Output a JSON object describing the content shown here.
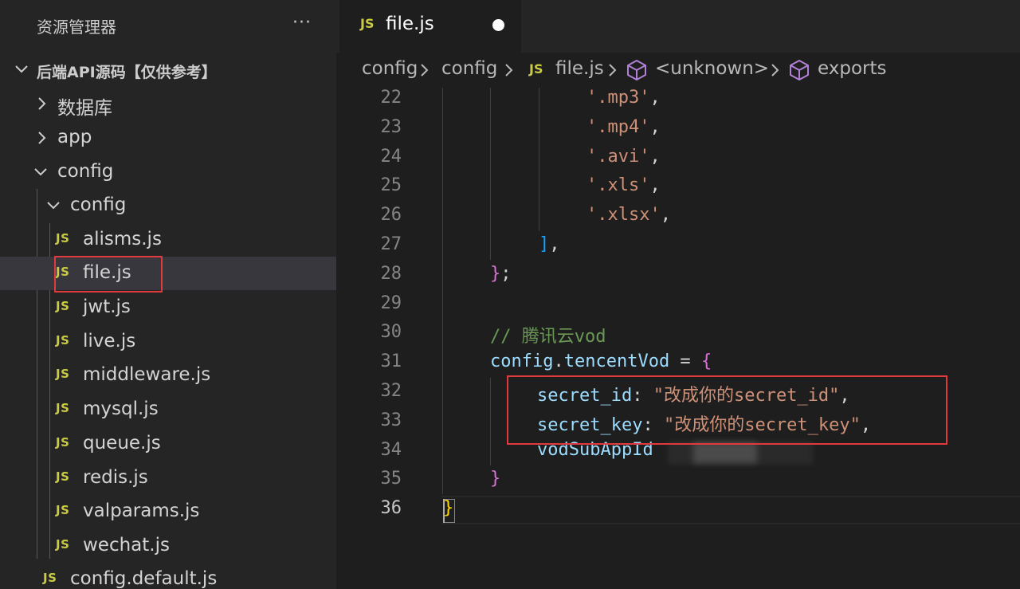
{
  "sidebar": {
    "title": "资源管理器",
    "more_label": "···",
    "root": "后端API源码【仅供参考】",
    "items": [
      {
        "label": "数据库",
        "kind": "folder",
        "expanded": false
      },
      {
        "label": "app",
        "kind": "folder",
        "expanded": false
      },
      {
        "label": "config",
        "kind": "folder",
        "expanded": true
      },
      {
        "label": "config",
        "kind": "folder",
        "expanded": true
      },
      {
        "label": "alisms.js",
        "kind": "js"
      },
      {
        "label": "file.js",
        "kind": "js",
        "selected": true
      },
      {
        "label": "jwt.js",
        "kind": "js"
      },
      {
        "label": "live.js",
        "kind": "js"
      },
      {
        "label": "middleware.js",
        "kind": "js"
      },
      {
        "label": "mysql.js",
        "kind": "js"
      },
      {
        "label": "queue.js",
        "kind": "js"
      },
      {
        "label": "redis.js",
        "kind": "js"
      },
      {
        "label": "valparams.js",
        "kind": "js"
      },
      {
        "label": "wechat.js",
        "kind": "js"
      },
      {
        "label": "config.default.js",
        "kind": "js"
      }
    ],
    "js_badge": "JS"
  },
  "tab": {
    "icon": "JS",
    "label": "file.js",
    "dirty": true
  },
  "breadcrumbs": {
    "items": [
      "config",
      "config",
      "file.js",
      "<unknown>",
      "exports"
    ],
    "file_icon": "JS"
  },
  "editor": {
    "lines": [
      {
        "n": "22",
        "segments": [
          {
            "t": "'.mp3'",
            "c": "str"
          },
          {
            "t": ",",
            "c": "punc"
          }
        ]
      },
      {
        "n": "23",
        "segments": [
          {
            "t": "'.mp4'",
            "c": "str"
          },
          {
            "t": ",",
            "c": "punc"
          }
        ]
      },
      {
        "n": "24",
        "segments": [
          {
            "t": "'.avi'",
            "c": "str"
          },
          {
            "t": ",",
            "c": "punc"
          }
        ]
      },
      {
        "n": "25",
        "segments": [
          {
            "t": "'.xls'",
            "c": "str"
          },
          {
            "t": ",",
            "c": "punc"
          }
        ]
      },
      {
        "n": "26",
        "segments": [
          {
            "t": "'.xlsx'",
            "c": "str"
          },
          {
            "t": ",",
            "c": "punc"
          }
        ]
      },
      {
        "n": "27",
        "segments": [
          {
            "t": "]",
            "c": "br2"
          },
          {
            "t": ",",
            "c": "punc"
          }
        ]
      },
      {
        "n": "28",
        "segments": [
          {
            "t": "}",
            "c": "br1"
          },
          {
            "t": ";",
            "c": "punc"
          }
        ]
      },
      {
        "n": "29",
        "segments": []
      },
      {
        "n": "30",
        "segments": [
          {
            "t": "// 腾讯云vod",
            "c": "com"
          }
        ]
      },
      {
        "n": "31",
        "segments": [
          {
            "t": "config",
            "c": "var"
          },
          {
            "t": ".",
            "c": "punc"
          },
          {
            "t": "tencentVod",
            "c": "var"
          },
          {
            "t": " = ",
            "c": "punc"
          },
          {
            "t": "{",
            "c": "br1"
          }
        ]
      },
      {
        "n": "32",
        "segments": [
          {
            "t": "secret_id",
            "c": "var"
          },
          {
            "t": ": ",
            "c": "punc"
          },
          {
            "t": "\"改成你的secret_id\"",
            "c": "str"
          },
          {
            "t": ",",
            "c": "punc"
          }
        ]
      },
      {
        "n": "33",
        "segments": [
          {
            "t": "secret_key",
            "c": "var"
          },
          {
            "t": ": ",
            "c": "punc"
          },
          {
            "t": "\"改成你的secret_key\"",
            "c": "str"
          },
          {
            "t": ",",
            "c": "punc"
          }
        ]
      },
      {
        "n": "34",
        "segments": [
          {
            "t": "vodSubAppId",
            "c": "var"
          }
        ]
      },
      {
        "n": "35",
        "segments": [
          {
            "t": "}",
            "c": "br1"
          }
        ]
      },
      {
        "n": "36",
        "segments": [
          {
            "t": "}",
            "c": "br3"
          }
        ]
      }
    ],
    "current_line": "36"
  },
  "colors": {
    "highlight_box": "#e0393e",
    "js_yellow": "#cbcb41",
    "cube_purple": "#b180d7"
  }
}
